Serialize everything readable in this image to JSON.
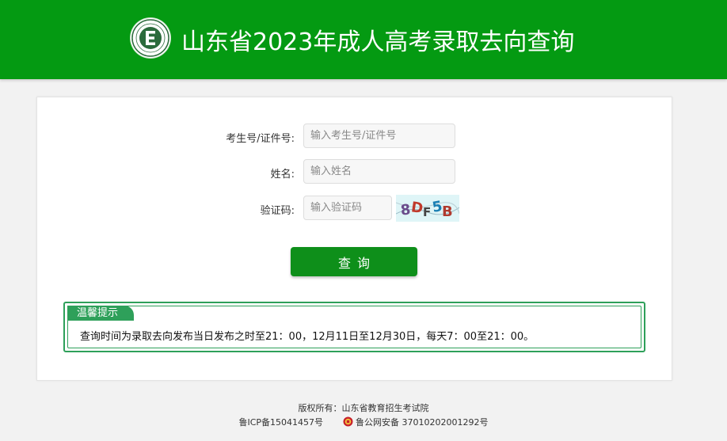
{
  "header": {
    "title": "山东省2023年成人高考录取去向查询",
    "logo_icon": "exam-authority-seal-icon"
  },
  "form": {
    "exam_id": {
      "label": "考生号/证件号:",
      "placeholder": "输入考生号/证件号",
      "value": ""
    },
    "name": {
      "label": "姓名:",
      "placeholder": "输入姓名",
      "value": ""
    },
    "captcha": {
      "label": "验证码:",
      "placeholder": "输入验证码",
      "value": "",
      "image_text": "8DF5B"
    },
    "submit_label": "查询"
  },
  "notice": {
    "title": "温馨提示",
    "text": "查询时间为录取去向发布当日发布之时至21：00，12月11日至12月30日，每天7：00至21：00。"
  },
  "footer": {
    "copyright": "版权所有：山东省教育招生考试院",
    "icp": "鲁ICP备15041457号",
    "police": "鲁公网安备 37010202001292号",
    "police_icon": "police-badge-icon"
  },
  "colors": {
    "header_green": "#049a12",
    "button_green": "#0e8f1a",
    "notice_green": "#2ea05a",
    "page_background": "#f2f2f2"
  }
}
